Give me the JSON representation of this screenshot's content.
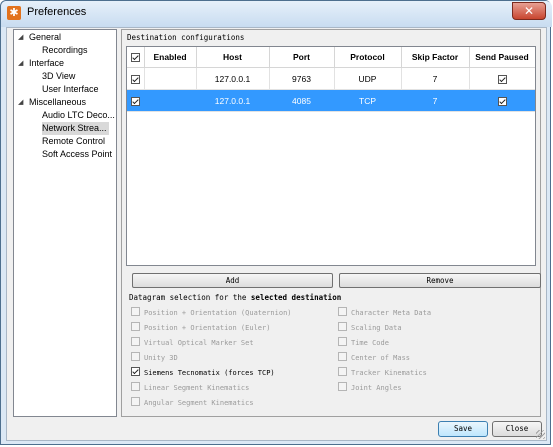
{
  "window": {
    "title": "Preferences",
    "close_glyph": "✕"
  },
  "tree": {
    "items": [
      {
        "label": "General",
        "level": 0,
        "expanded": true
      },
      {
        "label": "Recordings",
        "level": 1
      },
      {
        "label": "Interface",
        "level": 0,
        "expanded": true
      },
      {
        "label": "3D View",
        "level": 1
      },
      {
        "label": "User Interface",
        "level": 1
      },
      {
        "label": "Miscellaneous",
        "level": 0,
        "expanded": true
      },
      {
        "label": "Audio LTC Deco...",
        "level": 1
      },
      {
        "label": "Network Strea...",
        "level": 1,
        "selected": true
      },
      {
        "label": "Remote Control",
        "level": 1
      },
      {
        "label": "Soft Access Point",
        "level": 1
      }
    ]
  },
  "destinations": {
    "section_label": "Destination configurations",
    "header_checked": true,
    "columns": [
      "Enabled",
      "Host",
      "Port",
      "Protocol",
      "Skip Factor",
      "Send Paused"
    ],
    "rows": [
      {
        "enabled": true,
        "host": "127.0.0.1",
        "port": "9763",
        "protocol": "UDP",
        "skip_factor": "7",
        "send_paused": true,
        "selected": false
      },
      {
        "enabled": true,
        "host": "127.0.0.1",
        "port": "4085",
        "protocol": "TCP",
        "skip_factor": "7",
        "send_paused": true,
        "selected": true
      }
    ],
    "add_label": "Add",
    "remove_label": "Remove"
  },
  "datagram": {
    "label_prefix": "Datagram selection for the",
    "label_bold": "selected destination",
    "left": [
      {
        "label": "Position + Orientation (Quaternion)",
        "checked": false,
        "enabled": false
      },
      {
        "label": "Position + Orientation (Euler)",
        "checked": false,
        "enabled": false
      },
      {
        "label": "Virtual Optical Marker Set",
        "checked": false,
        "enabled": false
      },
      {
        "label": "Unity 3D",
        "checked": false,
        "enabled": false
      },
      {
        "label": "Siemens Tecnomatix (forces TCP)",
        "checked": true,
        "enabled": true
      },
      {
        "label": "Linear Segment Kinematics",
        "checked": false,
        "enabled": false
      },
      {
        "label": "Angular Segment Kinematics",
        "checked": false,
        "enabled": false
      }
    ],
    "right": [
      {
        "label": "Character Meta Data",
        "checked": false,
        "enabled": false
      },
      {
        "label": "Scaling Data",
        "checked": false,
        "enabled": false
      },
      {
        "label": "Time Code",
        "checked": false,
        "enabled": false
      },
      {
        "label": "Center of Mass",
        "checked": false,
        "enabled": false
      },
      {
        "label": "Tracker Kinematics",
        "checked": false,
        "enabled": false
      },
      {
        "label": "Joint Angles",
        "checked": false,
        "enabled": false
      }
    ]
  },
  "footer": {
    "save_label": "Save",
    "close_label": "Close"
  },
  "colors": {
    "selection": "#3399ff",
    "app_icon": "#e2721c",
    "close_button": "#c8452f"
  }
}
